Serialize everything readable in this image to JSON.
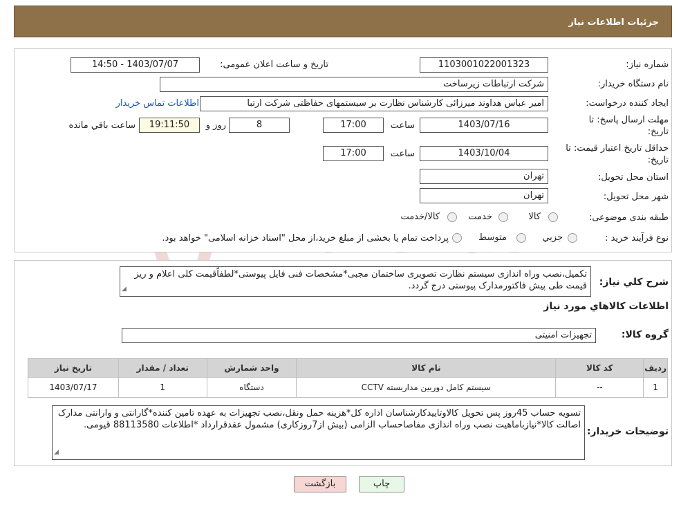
{
  "header": {
    "title": "جزئیات اطلاعات نیاز"
  },
  "form": {
    "need_number_label": "شماره نیاز:",
    "need_number": "1103001022001323",
    "announce_label": "تاریخ و ساعت اعلان عمومی:",
    "announce_value": "1403/07/07 - 14:50",
    "buyer_org_label": "نام دستگاه خریدار:",
    "buyer_org": "شرکت ارتباطات زیرساخت",
    "requester_label": "ایجاد کننده درخواست:",
    "requester": "امیر عباس هداوند میرزائی کارشناس نظارت بر سیستمهای حفاظتی شرکت ارتبا",
    "contact_link": "اطلاعات تماس خریدار",
    "deadline_label_1": "مهلت ارسال پاسخ: تا",
    "deadline_label_2": "تاریخ:",
    "deadline_date": "1403/07/16",
    "time_label": "ساعت",
    "deadline_time": "17:00",
    "days_value": "8",
    "days_label": "روز و",
    "remaining_time": "19:11:50",
    "remaining_label": "ساعت باقي مانده",
    "validity_label_1": "حداقل تاریخ اعتبار قیمت: تا",
    "validity_label_2": "تاریخ:",
    "validity_date": "1403/10/04",
    "validity_time": "17:00",
    "province_label": "استان محل تحویل:",
    "province": "تهران",
    "city_label": "شهر محل تحویل:",
    "city": "تهران",
    "category_label": "طبقه بندی موضوعی:",
    "category_options": [
      "کالا",
      "خدمت",
      "کالا/خدمت"
    ],
    "process_label": "نوع فرآیند خرید :",
    "process_options": [
      "جزیي",
      "متوسط"
    ],
    "process_note": "پرداخت تمام یا بخشی از مبلغ خرید،از محل \"اسناد خزانه اسلامی\" خواهد بود."
  },
  "details": {
    "summary_label": "شرح کلي نياز:",
    "summary": "تکمیل،نصب وراه اندازی سیستم نظارت تصویری ساختمان مجبی*مشخصات فنی فایل پیوستی*لطفاًقیمت کلی اعلام و ریز قیمت طی پیش فاکتورمدارک پیوستی درج گردد.",
    "goods_info_title": "اطلاعات کالاهاي مورد نياز",
    "goods_group_label": "گروه کالا:",
    "goods_group": "تجهیزات امنیتی",
    "table": {
      "headers": [
        "ردیف",
        "کد کالا",
        "نام کالا",
        "واحد شمارش",
        "تعداد / مقدار",
        "تاریخ نیاز"
      ],
      "rows": [
        [
          "1",
          "--",
          "سیستم کامل دوربین مداربسته CCTV",
          "دستگاه",
          "1",
          "1403/07/17"
        ]
      ]
    },
    "buyer_notes_label": "توضیحات خریدار:",
    "buyer_notes": "تسویه حساب 45روز پس تحویل کالاوتاییدکارشناسان  اداره کل*هزینه حمل ونقل،نصب تجهیزات به عهده تامین کننده*گارانتی و وارانتی مدارک اصالت کالا*نیازباماهیت نصب وراه اندازی مفاصاحساب الزامی (بیش از7روزکاری) مشمول عقدقرارداد *اطلاعات 88113580 قیومی."
  },
  "buttons": {
    "print": "چاپ",
    "back": "بازگشت"
  },
  "watermark": {
    "text": "AriaTender.neT"
  },
  "colors": {
    "header_bg": "#8e7148",
    "link": "#1b58b8",
    "back_button_bg": "#f7d7d4",
    "print_button_bg": "#e8f8e6"
  }
}
